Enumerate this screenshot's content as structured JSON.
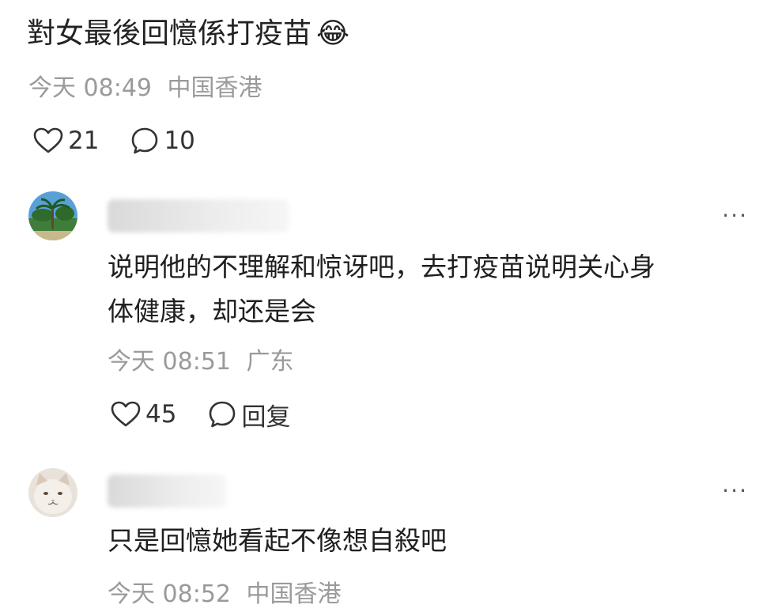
{
  "post": {
    "text": "對女最後回憶係打疫苗",
    "emoji": "😂",
    "time": "今天 08:49",
    "location": "中国香港",
    "likes": "21",
    "comments": "10"
  },
  "comments": [
    {
      "text_line1": "说明他的不理解和惊讶吧，去打疫苗说明关心身",
      "text_line2": "体健康，却还是会",
      "time": "今天 08:51",
      "location": "广东",
      "likes": "45",
      "reply_label": "回复",
      "more_label": "···"
    },
    {
      "text_line1": "只是回憶她看起不像想自殺吧",
      "time": "今天 08:52",
      "location": "中国香港",
      "more_label": "···"
    }
  ],
  "colors": {
    "meta": "#9a9a9a",
    "text": "#1f1f1f"
  }
}
